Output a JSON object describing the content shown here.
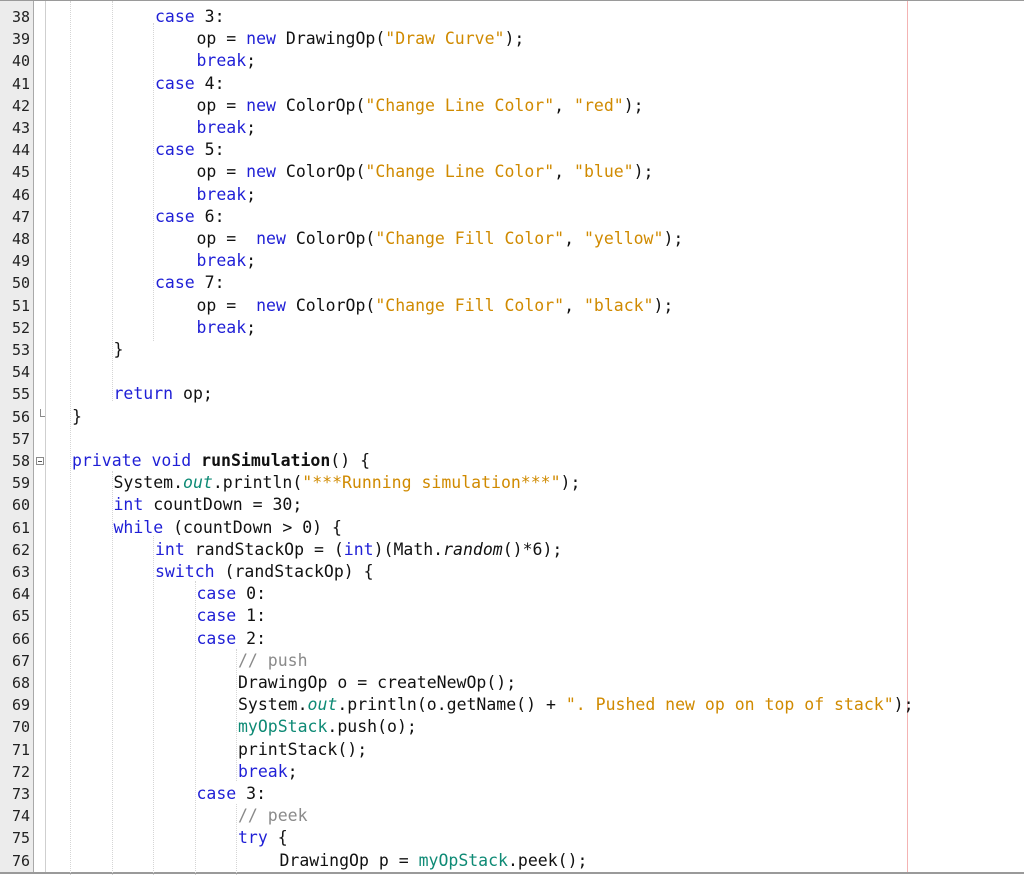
{
  "editor": {
    "lines": [
      {
        "n": "38",
        "indent": 3,
        "tokens": [
          {
            "t": "case",
            "c": "k"
          },
          {
            "t": " 3:"
          }
        ]
      },
      {
        "n": "39",
        "indent": 4,
        "tokens": [
          {
            "t": "op = "
          },
          {
            "t": "new",
            "c": "k"
          },
          {
            "t": " DrawingOp("
          },
          {
            "t": "\"Draw Curve\"",
            "c": "s"
          },
          {
            "t": ");"
          }
        ]
      },
      {
        "n": "40",
        "indent": 4,
        "tokens": [
          {
            "t": "break",
            "c": "k"
          },
          {
            "t": ";"
          }
        ]
      },
      {
        "n": "41",
        "indent": 3,
        "tokens": [
          {
            "t": "case",
            "c": "k"
          },
          {
            "t": " 4:"
          }
        ]
      },
      {
        "n": "42",
        "indent": 4,
        "tokens": [
          {
            "t": "op = "
          },
          {
            "t": "new",
            "c": "k"
          },
          {
            "t": " ColorOp("
          },
          {
            "t": "\"Change Line Color\"",
            "c": "s"
          },
          {
            "t": ", "
          },
          {
            "t": "\"red\"",
            "c": "s"
          },
          {
            "t": ");"
          }
        ]
      },
      {
        "n": "43",
        "indent": 4,
        "tokens": [
          {
            "t": "break",
            "c": "k"
          },
          {
            "t": ";"
          }
        ]
      },
      {
        "n": "44",
        "indent": 3,
        "tokens": [
          {
            "t": "case",
            "c": "k"
          },
          {
            "t": " 5:"
          }
        ]
      },
      {
        "n": "45",
        "indent": 4,
        "tokens": [
          {
            "t": "op = "
          },
          {
            "t": "new",
            "c": "k"
          },
          {
            "t": " ColorOp("
          },
          {
            "t": "\"Change Line Color\"",
            "c": "s"
          },
          {
            "t": ", "
          },
          {
            "t": "\"blue\"",
            "c": "s"
          },
          {
            "t": ");"
          }
        ]
      },
      {
        "n": "46",
        "indent": 4,
        "tokens": [
          {
            "t": "break",
            "c": "k"
          },
          {
            "t": ";"
          }
        ]
      },
      {
        "n": "47",
        "indent": 3,
        "tokens": [
          {
            "t": "case",
            "c": "k"
          },
          {
            "t": " 6:"
          }
        ]
      },
      {
        "n": "48",
        "indent": 4,
        "tokens": [
          {
            "t": "op =  "
          },
          {
            "t": "new",
            "c": "k"
          },
          {
            "t": " ColorOp("
          },
          {
            "t": "\"Change Fill Color\"",
            "c": "s"
          },
          {
            "t": ", "
          },
          {
            "t": "\"yellow\"",
            "c": "s"
          },
          {
            "t": ");"
          }
        ]
      },
      {
        "n": "49",
        "indent": 4,
        "tokens": [
          {
            "t": "break",
            "c": "k"
          },
          {
            "t": ";"
          }
        ]
      },
      {
        "n": "50",
        "indent": 3,
        "tokens": [
          {
            "t": "case",
            "c": "k"
          },
          {
            "t": " 7:"
          }
        ]
      },
      {
        "n": "51",
        "indent": 4,
        "tokens": [
          {
            "t": "op =  "
          },
          {
            "t": "new",
            "c": "k"
          },
          {
            "t": " ColorOp("
          },
          {
            "t": "\"Change Fill Color\"",
            "c": "s"
          },
          {
            "t": ", "
          },
          {
            "t": "\"black\"",
            "c": "s"
          },
          {
            "t": ");"
          }
        ]
      },
      {
        "n": "52",
        "indent": 4,
        "tokens": [
          {
            "t": "break",
            "c": "k"
          },
          {
            "t": ";"
          }
        ]
      },
      {
        "n": "53",
        "indent": 2,
        "tokens": [
          {
            "t": "}"
          }
        ]
      },
      {
        "n": "54",
        "indent": 0,
        "tokens": []
      },
      {
        "n": "55",
        "indent": 2,
        "tokens": [
          {
            "t": "return",
            "c": "k"
          },
          {
            "t": " op;"
          }
        ]
      },
      {
        "n": "56",
        "indent": 1,
        "fold": "end",
        "tokens": [
          {
            "t": "}"
          }
        ]
      },
      {
        "n": "57",
        "indent": 0,
        "tokens": []
      },
      {
        "n": "58",
        "indent": 1,
        "fold": "start",
        "tokens": [
          {
            "t": "private void",
            "c": "k"
          },
          {
            "t": " "
          },
          {
            "t": "runSimulation",
            "c": "b"
          },
          {
            "t": "() {"
          }
        ]
      },
      {
        "n": "59",
        "indent": 2,
        "tokens": [
          {
            "t": "System."
          },
          {
            "t": "out",
            "c": "f i"
          },
          {
            "t": ".println("
          },
          {
            "t": "\"***Running simulation***\"",
            "c": "s"
          },
          {
            "t": ");"
          }
        ]
      },
      {
        "n": "60",
        "indent": 2,
        "tokens": [
          {
            "t": "int",
            "c": "k"
          },
          {
            "t": " countDown = 30;"
          }
        ]
      },
      {
        "n": "61",
        "indent": 2,
        "tokens": [
          {
            "t": "while",
            "c": "k"
          },
          {
            "t": " (countDown > 0) {"
          }
        ]
      },
      {
        "n": "62",
        "indent": 3,
        "tokens": [
          {
            "t": "int",
            "c": "k"
          },
          {
            "t": " randStackOp = ("
          },
          {
            "t": "int",
            "c": "k"
          },
          {
            "t": ")(Math."
          },
          {
            "t": "random",
            "c": "i"
          },
          {
            "t": "()*6);"
          }
        ]
      },
      {
        "n": "63",
        "indent": 3,
        "tokens": [
          {
            "t": "switch",
            "c": "k"
          },
          {
            "t": " (randStackOp) {"
          }
        ]
      },
      {
        "n": "64",
        "indent": 4,
        "tokens": [
          {
            "t": "case",
            "c": "k"
          },
          {
            "t": " 0:"
          }
        ]
      },
      {
        "n": "65",
        "indent": 4,
        "tokens": [
          {
            "t": "case",
            "c": "k"
          },
          {
            "t": " 1:"
          }
        ]
      },
      {
        "n": "66",
        "indent": 4,
        "tokens": [
          {
            "t": "case",
            "c": "k"
          },
          {
            "t": " 2:"
          }
        ]
      },
      {
        "n": "67",
        "indent": 5,
        "tokens": [
          {
            "t": "// push",
            "c": "c"
          }
        ]
      },
      {
        "n": "68",
        "indent": 5,
        "tokens": [
          {
            "t": "DrawingOp o = createNewOp();"
          }
        ]
      },
      {
        "n": "69",
        "indent": 5,
        "tokens": [
          {
            "t": "System."
          },
          {
            "t": "out",
            "c": "f i"
          },
          {
            "t": ".println(o.getName() + "
          },
          {
            "t": "\". Pushed new op on top of stack\"",
            "c": "s"
          },
          {
            "t": ");"
          }
        ]
      },
      {
        "n": "70",
        "indent": 5,
        "tokens": [
          {
            "t": "myOpStack",
            "c": "f"
          },
          {
            "t": ".push(o);"
          }
        ]
      },
      {
        "n": "71",
        "indent": 5,
        "tokens": [
          {
            "t": "printStack();"
          }
        ]
      },
      {
        "n": "72",
        "indent": 5,
        "tokens": [
          {
            "t": "break",
            "c": "k"
          },
          {
            "t": ";"
          }
        ]
      },
      {
        "n": "73",
        "indent": 4,
        "tokens": [
          {
            "t": "case",
            "c": "k"
          },
          {
            "t": " 3:"
          }
        ]
      },
      {
        "n": "74",
        "indent": 5,
        "tokens": [
          {
            "t": "// peek",
            "c": "c"
          }
        ]
      },
      {
        "n": "75",
        "indent": 5,
        "tokens": [
          {
            "t": "try",
            "c": "k"
          },
          {
            "t": " {"
          }
        ]
      },
      {
        "n": "76",
        "indent": 6,
        "tokens": [
          {
            "t": "DrawingOp p = "
          },
          {
            "t": "myOpStack",
            "c": "f"
          },
          {
            "t": ".peek();"
          }
        ]
      }
    ]
  }
}
